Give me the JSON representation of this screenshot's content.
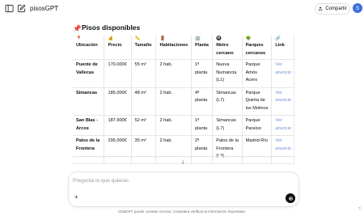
{
  "header": {
    "app_title": "pisosGPT",
    "share_label": "Compartir",
    "avatar_initial": "S"
  },
  "content": {
    "heading": "Pisos disponibles",
    "columns": [
      {
        "icon": "📍",
        "label": "Ubicación"
      },
      {
        "icon": "💰",
        "label": "Precio"
      },
      {
        "icon": "📏",
        "label": "Tamaño"
      },
      {
        "icon": "🚪",
        "label": "Habitaciones"
      },
      {
        "icon": "🏢",
        "label": "Planta"
      },
      {
        "icon": "🚇",
        "label": "Metro cercano"
      },
      {
        "icon": "🌳",
        "label": "Parques cercanos"
      },
      {
        "icon": "🔗",
        "label": "Link"
      }
    ],
    "rows": [
      {
        "ubicacion": "Puente de Vallecas",
        "precio": "170.000€",
        "tamano": "55 m²",
        "habitaciones": "2 hab.",
        "planta": "1ª planta",
        "metro": "Nueva Numancia (L1)",
        "parques": "Parque Amós Acero",
        "link": "Ver anuncio"
      },
      {
        "ubicacion": "Simancas",
        "precio": "185.000€",
        "tamano": "48 m²",
        "habitaciones": "2 hab.",
        "planta": "4ª planta",
        "metro": "Simancas (L7)",
        "parques": "Parque Quinta de los Molinos",
        "link": "Ver anuncio"
      },
      {
        "ubicacion": "San Blas - Arcos",
        "precio": "187.900€",
        "tamano": "52 m²",
        "habitaciones": "2 hab.",
        "planta": "1ª planta",
        "metro": "Simancas (L7)",
        "parques": "Parque Paraíso",
        "link": "Ver anuncio"
      },
      {
        "ubicacion": "Palos de la Frontera",
        "precio": "295.000€",
        "tamano": "35 m²",
        "habitaciones": "2 hab.",
        "planta": "2ª planta",
        "metro": "Palos de la Frontera (L3)",
        "parques": "Madrid Río",
        "link": "Ver anuncio"
      }
    ]
  },
  "composer": {
    "placeholder": "Pregunta lo que quieras"
  },
  "footer": {
    "disclaimer": "ChatGPT puede cometer errores. Considera verificar la información importante.",
    "help": "?"
  },
  "icons": {
    "sidebar_toggle": "sidebar-icon",
    "new_chat": "edit-icon",
    "menu": "ellipsis-icon",
    "share": "share-icon",
    "scroll_down": "arrow-down-icon",
    "attach": "plus-icon",
    "voice": "voice-waveform-icon"
  },
  "colors": {
    "link": "#6b8fd9",
    "avatar_bg": "#3b6fd8",
    "voice_button": "#0d0d0d"
  }
}
